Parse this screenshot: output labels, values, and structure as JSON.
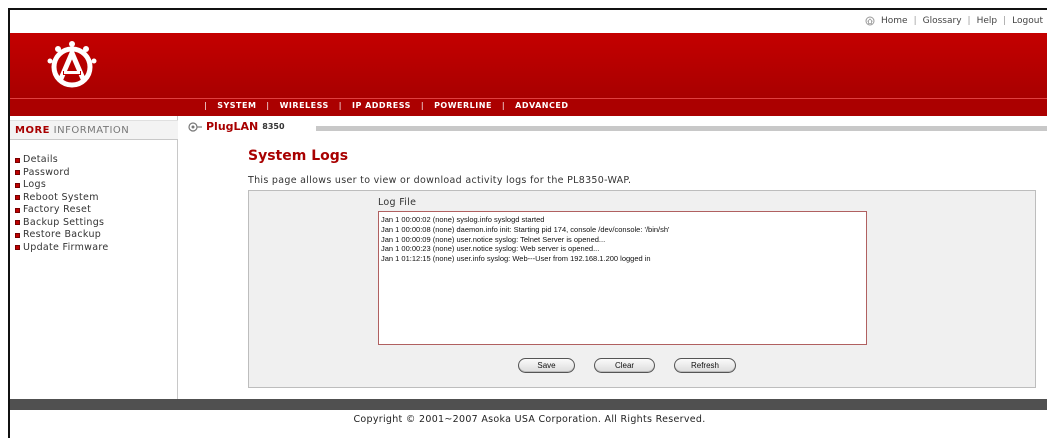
{
  "toplinks": {
    "home_icon": "home-icon",
    "items": [
      "Home",
      "Glossary",
      "Help",
      "Logout"
    ]
  },
  "nav": {
    "items": [
      "SYSTEM",
      "WIRELESS",
      "IP ADDRESS",
      "POWERLINE",
      "ADVANCED"
    ]
  },
  "sidebar": {
    "heading_bold": "MORE",
    "heading_rest": "INFORMATION",
    "items": [
      "Details",
      "Password",
      "Logs",
      "Reboot System",
      "Factory Reset",
      "Backup Settings",
      "Restore Backup",
      "Update Firmware"
    ]
  },
  "product": {
    "name": "PlugLAN",
    "model": "8350"
  },
  "main": {
    "title": "System Logs",
    "description": "This page allows user to view or download activity logs for the PL8350-WAP.",
    "log_label": "Log File",
    "log_lines": [
      "Jan  1 00:00:02 (none) syslog.info syslogd started",
      "Jan  1 00:00:08 (none) daemon.info init: Starting pid 174, console /dev/console: '/bin/sh'",
      "Jan  1 00:00:09 (none) user.notice syslog: Telnet Server is opened...",
      "Jan  1 00:00:23 (none) user.notice syslog: Web server is opened...",
      "Jan  1 01:12:15 (none) user.info syslog: Web---User from 192.168.1.200 logged in"
    ],
    "buttons": {
      "save": "Save",
      "clear": "Clear",
      "refresh": "Refresh"
    }
  },
  "footer": {
    "copyright": "Copyright © 2001~2007 Asoka USA Corporation. All Rights Reserved."
  },
  "colors": {
    "brand_red": "#a80000",
    "footer_gray": "#505050"
  }
}
